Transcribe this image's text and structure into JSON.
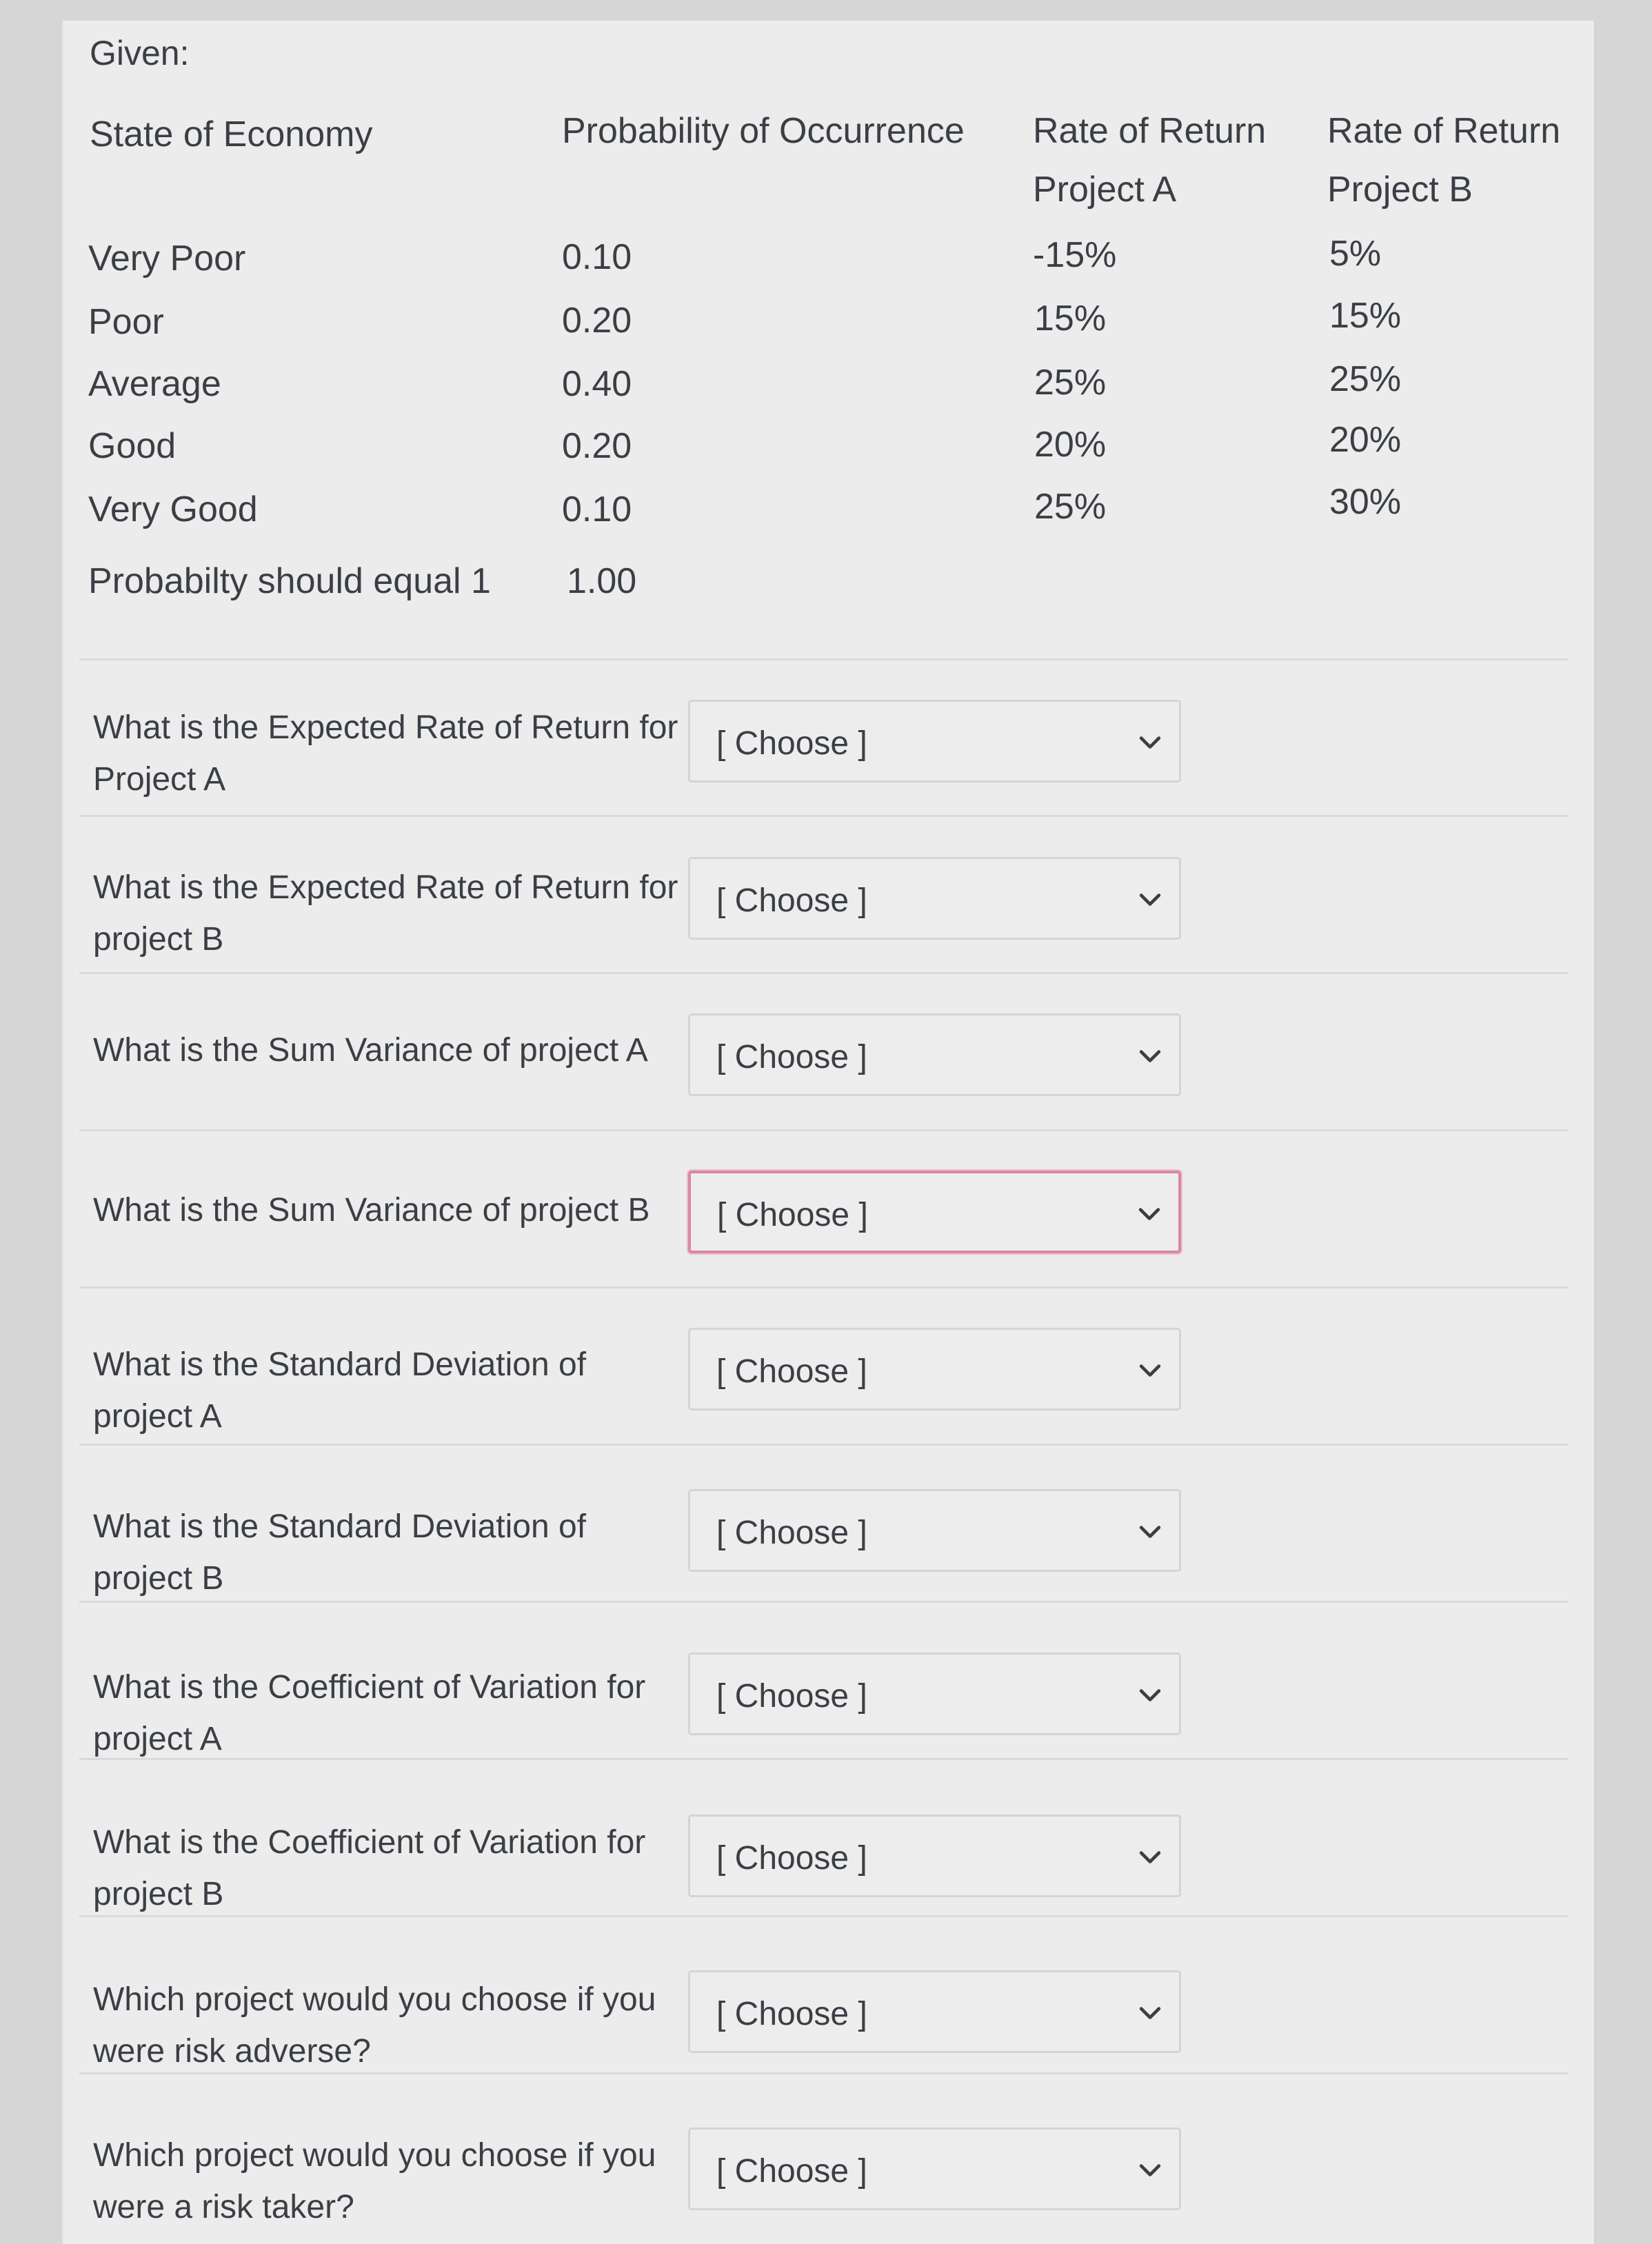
{
  "given": {
    "label": "Given:",
    "headers": {
      "state": "State of Economy",
      "probability": "Probability of Occurrence",
      "rate_a_line1": "Rate of Return",
      "rate_a_line2": "Project A",
      "rate_b_line1": "Rate of Return",
      "rate_b_line2": "Project B"
    },
    "rows": [
      {
        "state": "Very Poor",
        "probability": "0.10",
        "project_a": "-15%",
        "project_b": "5%"
      },
      {
        "state": "Poor",
        "probability": "0.20",
        "project_a": "15%",
        "project_b": "15%"
      },
      {
        "state": "Average",
        "probability": "0.40",
        "project_a": "25%",
        "project_b": "25%"
      },
      {
        "state": "Good",
        "probability": "0.20",
        "project_a": "20%",
        "project_b": "20%"
      },
      {
        "state": "Very Good",
        "probability": "0.10",
        "project_a": "25%",
        "project_b": "30%"
      }
    ],
    "total": {
      "label": "Probabilty should equal 1",
      "value": "1.00"
    }
  },
  "questions": [
    {
      "text": "What is the Expected Rate of Return for Project A",
      "selected": "[ Choose ]"
    },
    {
      "text": "What is the Expected Rate of Return for project B",
      "selected": "[ Choose ]"
    },
    {
      "text": "What is the Sum Variance of project A",
      "selected": "[ Choose ]"
    },
    {
      "text": "What is the Sum Variance of project B",
      "selected": "[ Choose ]"
    },
    {
      "text": "What is the Standard Deviation of project A",
      "selected": "[ Choose ]"
    },
    {
      "text": "What is the Standard Deviation of project B",
      "selected": "[ Choose ]"
    },
    {
      "text": "What is the Coefficient of Variation for project A",
      "selected": "[ Choose ]"
    },
    {
      "text": "What is the Coefficient of Variation for project B",
      "selected": "[ Choose ]"
    },
    {
      "text": "Which project would you choose if you were risk adverse?",
      "selected": "[ Choose ]"
    },
    {
      "text": "Which project would you choose if you were a risk taker?",
      "selected": "[ Choose ]"
    }
  ],
  "dropdown_icon": "chevron-down-icon",
  "focus_color": "#d9899f"
}
